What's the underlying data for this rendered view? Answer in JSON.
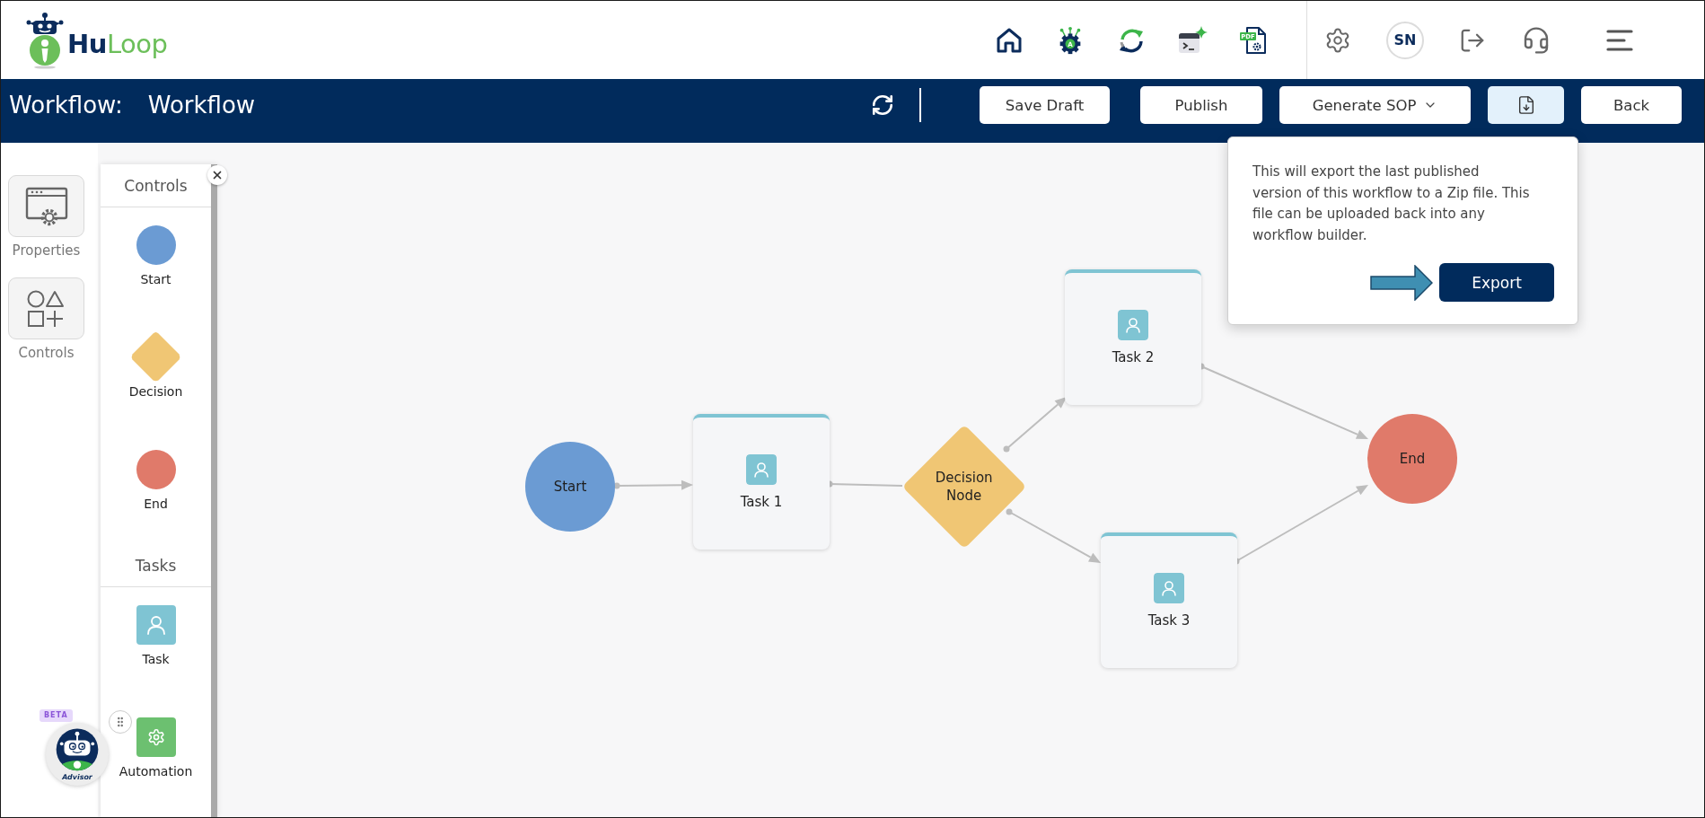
{
  "header": {
    "brand": {
      "first": "Hu",
      "second": "Loop"
    },
    "robot_icon_letter": "A",
    "pdf_icon_label": "PDF",
    "user_initials": "SN"
  },
  "toolbar": {
    "title_label": "Workflow:",
    "title": "Workflow",
    "buttons": [
      {
        "kind": "text",
        "label": "Save Draft",
        "expanded": false
      },
      {
        "kind": "text",
        "label": "Publish",
        "expanded": false
      },
      {
        "kind": "dropdown",
        "label": "Generate SOP",
        "expanded": false
      },
      {
        "kind": "icon",
        "expanded": true
      },
      {
        "kind": "text",
        "label": "Back",
        "expanded": false
      }
    ]
  },
  "export_popover": {
    "text": "This will export the last published version of this workflow to a Zip file. This file can be uploaded back into any workflow builder.",
    "button": "Export"
  },
  "side_rail": [
    {
      "label": "Properties"
    },
    {
      "label": "Controls"
    }
  ],
  "palette": {
    "sections": [
      {
        "title": "Controls",
        "items": [
          {
            "kind": "start",
            "label": "Start"
          },
          {
            "kind": "decision",
            "label": "Decision"
          },
          {
            "kind": "end",
            "label": "End"
          }
        ]
      },
      {
        "title": "Tasks",
        "items": [
          {
            "kind": "task",
            "label": "Task"
          },
          {
            "kind": "automation",
            "label": "Automation"
          }
        ]
      }
    ]
  },
  "canvas": {
    "nodes": [
      {
        "kind": "start",
        "label": "Start"
      },
      {
        "kind": "task",
        "label": "Task 1"
      },
      {
        "kind": "decision",
        "label": "Decision Node"
      },
      {
        "kind": "task",
        "label": "Task 2"
      },
      {
        "kind": "task",
        "label": "Task 3"
      },
      {
        "kind": "end",
        "label": "End"
      }
    ]
  },
  "advisor": {
    "badge": "BETA",
    "label": "Advisor"
  }
}
